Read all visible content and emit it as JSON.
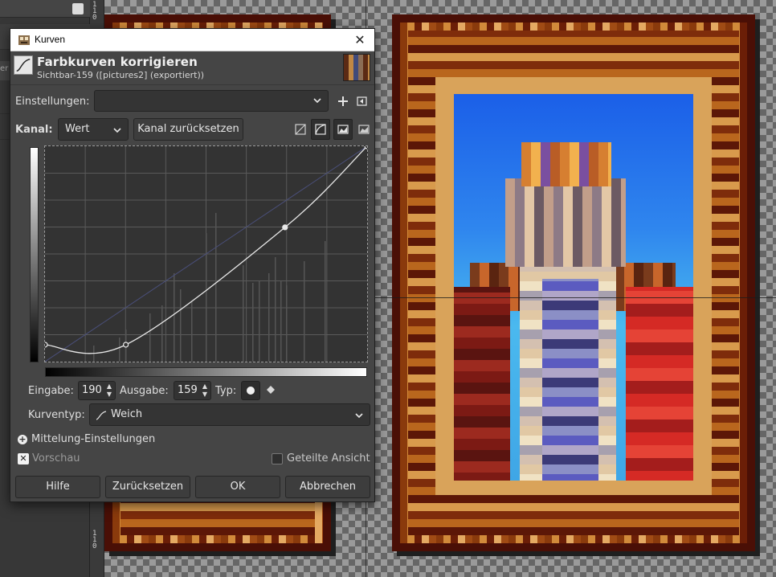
{
  "dialog": {
    "window_title": "Kurven",
    "close_glyph": "✕",
    "header_title": "Farbkurven korrigieren",
    "header_subtitle": "Sichtbar-159 ([pictures2] (exportiert))",
    "settings_label": "Einstellungen:",
    "settings_value": "",
    "channel_label": "Kanal:",
    "channel_value": "Wert",
    "reset_channel_label": "Kanal zurücksetzen",
    "input_label": "Eingabe:",
    "input_value": "190",
    "output_label": "Ausgabe:",
    "output_value": "159",
    "type_label": "Typ:",
    "curve_type_label": "Kurventyp:",
    "curve_type_value": "Weich",
    "averaging_label": "Mittelung-Einstellungen",
    "preview_label": "Vorschau",
    "split_view_label": "Geteilte Ansicht",
    "buttons": {
      "help": "Hilfe",
      "reset": "Zurücksetzen",
      "ok": "OK",
      "cancel": "Abbrechen"
    },
    "preview_checked": true,
    "split_view_checked": false
  },
  "curve": {
    "points": [
      [
        0,
        20
      ],
      [
        64,
        20
      ],
      [
        190,
        159
      ],
      [
        255,
        255
      ]
    ]
  },
  "ruler": {
    "top_digits": [
      "1",
      "1",
      "0"
    ],
    "bottom_digits": [
      "1",
      "1",
      "0"
    ]
  },
  "dock": {
    "cut_text": "er"
  },
  "colors": {
    "dialog_bg": "#454545",
    "curve_bg": "#333333",
    "curve_line": "#e8e8e8",
    "sky": "#1b5fe8",
    "frame_dark": "#4a0f06"
  },
  "icons": {
    "app": "gimp-wilber-icon",
    "curves": "curves-icon",
    "add": "plus-icon",
    "menu": "settings-menu-icon",
    "linear": "linear-histogram-icon",
    "log": "log-histogram-icon",
    "smooth": "smooth-point-icon",
    "corner": "corner-point-icon"
  }
}
